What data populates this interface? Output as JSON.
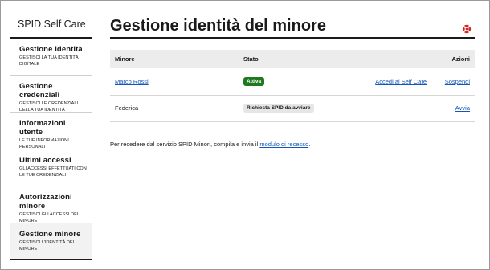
{
  "sidebar": {
    "brand": "SPID Self Care",
    "items": [
      {
        "title": "Gestione identità",
        "desc": "Gestisci la tua identità digitale"
      },
      {
        "title": "Gestione credenziali",
        "desc": "Gestisci le credenziali della tua identità"
      },
      {
        "title": "Informazioni utente",
        "desc": "Le tue informazioni personali"
      },
      {
        "title": "Ultimi accessi",
        "desc": "Gli accessi effettuati con le tue credenziali"
      },
      {
        "title": "Autorizzazioni minore",
        "desc": "Gestisci gli accessi del minore"
      },
      {
        "title": "Gestione minore",
        "desc": "Gestisci l'identità del minore"
      }
    ]
  },
  "main": {
    "title": "Gestione identità del minore",
    "table": {
      "headers": {
        "minore": "Minore",
        "stato": "Stato",
        "azioni": "Azioni"
      },
      "rows": [
        {
          "name": "Marco Rossi",
          "status": "Attiva",
          "action1": "Accedi al Self Care",
          "action2": "Sospendi"
        },
        {
          "name": "Federica",
          "status": "Richiesta SPID da avviare",
          "action1": "",
          "action2": "Avvia"
        }
      ]
    },
    "note": {
      "before": "Per recedere dal servizio SPID Minori, compila e invia il ",
      "link": "modulo di recesso",
      "after": "."
    }
  },
  "colors": {
    "accent_link": "#1456b8",
    "status_active": "#1f7a1f",
    "close_icon": "#d62828"
  },
  "icons": {
    "close": "lifebuoy-close-icon"
  }
}
